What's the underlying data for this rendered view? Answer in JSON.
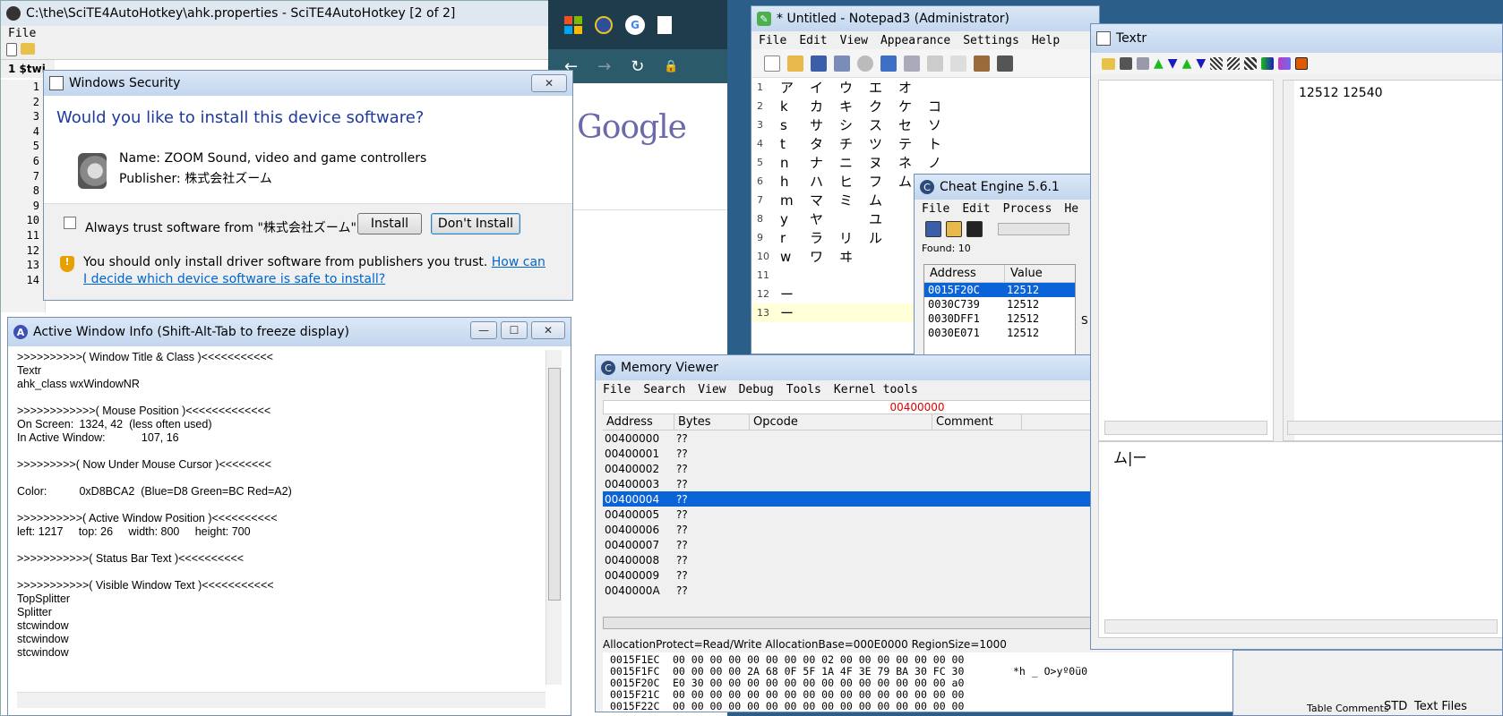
{
  "scite": {
    "title": "C:\\the\\SciTE4AutoHotkey\\ahk.properties - SciTE4AutoHotkey [2 of 2]",
    "menu_file": "File",
    "tab_label": "1 $twi",
    "line_numbers": [
      "1",
      "2",
      "3",
      "4",
      "5",
      "6",
      "7",
      "8",
      "9",
      "10",
      "11",
      "12",
      "13",
      "14"
    ]
  },
  "security": {
    "title": "Windows Security",
    "question": "Would you like to install this device software?",
    "name_line": "Name: ZOOM Sound, video and game controllers",
    "publisher_line": "Publisher: 株式会社ズーム",
    "always_trust": "Always trust software from \"株式会社ズーム\".",
    "install": "Install",
    "dont_install": "Don't Install",
    "warning": "You should only install driver software from publishers you trust.",
    "link": "How can I decide which device software is safe to install?"
  },
  "awi": {
    "title": "Active Window Info (Shift-Alt-Tab to freeze display)",
    "lines": [
      ">>>>>>>>>>( Window Title & Class )<<<<<<<<<<<",
      "Textr",
      "ahk_class wxWindowNR",
      "",
      ">>>>>>>>>>>>( Mouse Position )<<<<<<<<<<<<<",
      "On Screen:\t1324, 42  (less often used)",
      "In Active Window:\t107, 16",
      "",
      ">>>>>>>>>( Now Under Mouse Cursor )<<<<<<<<",
      "",
      "Color:\t0xD8BCA2  (Blue=D8 Green=BC Red=A2)",
      "",
      ">>>>>>>>>>( Active Window Position )<<<<<<<<<<",
      "left: 1217     top: 26     width: 800     height: 700",
      "",
      ">>>>>>>>>>>( Status Bar Text )<<<<<<<<<<",
      "",
      ">>>>>>>>>>>( Visible Window Text )<<<<<<<<<<<",
      "TopSplitter",
      "Splitter",
      "stcwindow",
      "stcwindow",
      "stcwindow"
    ]
  },
  "browser": {
    "logo": "Google"
  },
  "notepad": {
    "title": "* Untitled - Notepad3 (Administrator)",
    "menu": [
      "File",
      "Edit",
      "View",
      "Appearance",
      "Settings",
      "Help"
    ],
    "lines": [
      [
        "1",
        "ア",
        "イ",
        "ウ",
        "エ",
        "オ",
        ""
      ],
      [
        "2",
        "k",
        "カ",
        "キ",
        "ク",
        "ケ",
        "コ"
      ],
      [
        "3",
        "s",
        "サ",
        "シ",
        "ス",
        "セ",
        "ソ"
      ],
      [
        "4",
        "t",
        "タ",
        "チ",
        "ツ",
        "テ",
        "ト"
      ],
      [
        "5",
        "n",
        "ナ",
        "ニ",
        "ヌ",
        "ネ",
        "ノ"
      ],
      [
        "6",
        "h",
        "ハ",
        "ヒ",
        "フ",
        "ム",
        ""
      ],
      [
        "7",
        "m",
        "マ",
        "ミ",
        "ム",
        "",
        ""
      ],
      [
        "8",
        "y",
        "ヤ",
        "",
        "ユ",
        "",
        ""
      ],
      [
        "9",
        "r",
        "ラ",
        "リ",
        "ル",
        "",
        ""
      ],
      [
        "10",
        "w",
        "ワ",
        "ヰ",
        "",
        "",
        ""
      ],
      [
        "11",
        "",
        "",
        "",
        "",
        "",
        ""
      ],
      [
        "12",
        "ー",
        "",
        "",
        "",
        "",
        ""
      ],
      [
        "13",
        "ー",
        "",
        "",
        "",
        "",
        ""
      ]
    ]
  },
  "cheat": {
    "title": "Cheat Engine 5.6.1",
    "menu": [
      "File",
      "Edit",
      "Process",
      "He"
    ],
    "found": "Found: 10",
    "col_address": "Address",
    "col_value": "Value",
    "rows": [
      [
        "0015F20C",
        "12512"
      ],
      [
        "0030C739",
        "12512"
      ],
      [
        "0030DFF1",
        "12512"
      ],
      [
        "0030E071",
        "12512"
      ]
    ],
    "side_letter": "S"
  },
  "memview": {
    "title": "Memory Viewer",
    "menu": [
      "File",
      "Search",
      "View",
      "Debug",
      "Tools",
      "Kernel tools"
    ],
    "address_top": "00400000",
    "col_address": "Address",
    "col_bytes": "Bytes",
    "col_opcode": "Opcode",
    "col_comment": "Comment",
    "rows": [
      [
        "00400000",
        "??"
      ],
      [
        "00400001",
        "??"
      ],
      [
        "00400002",
        "??"
      ],
      [
        "00400003",
        "??"
      ],
      [
        "00400004",
        "??"
      ],
      [
        "00400005",
        "??"
      ],
      [
        "00400006",
        "??"
      ],
      [
        "00400007",
        "??"
      ],
      [
        "00400008",
        "??"
      ],
      [
        "00400009",
        "??"
      ],
      [
        "0040000A",
        "??"
      ]
    ],
    "alloc": "AllocationProtect=Read/Write  AllocationBase=000E0000 RegionSize=1000",
    "hex": [
      [
        "0015F1EC",
        "00 00 00 00 00 00 00 00 02 00 00 00 00 00 00 00",
        ""
      ],
      [
        "0015F1FC",
        "00 00 00 00 2A 68 0F 5F 1A 4F 3E 79 BA 30 FC 30",
        "*h _ O>yº0ü0"
      ],
      [
        "0015F20C",
        "E0 30 00 00 00 00 00 00 00 00 00 00 00 00 00 a0",
        ""
      ],
      [
        "0015F21C",
        "00 00 00 00 00 00 00 00 00 00 00 00 00 00 00 00",
        ""
      ],
      [
        "0015F22C",
        "00 00 00 00 00 00 00 00 00 00 00 00 00 00 00 00",
        ""
      ]
    ]
  },
  "textr": {
    "title": "Textr",
    "content": "12512 12540",
    "editor_text": "ム|ー"
  },
  "bottom": {
    "table_comments": "Table Comments",
    "std": "STD",
    "text_files": "Text Files"
  }
}
